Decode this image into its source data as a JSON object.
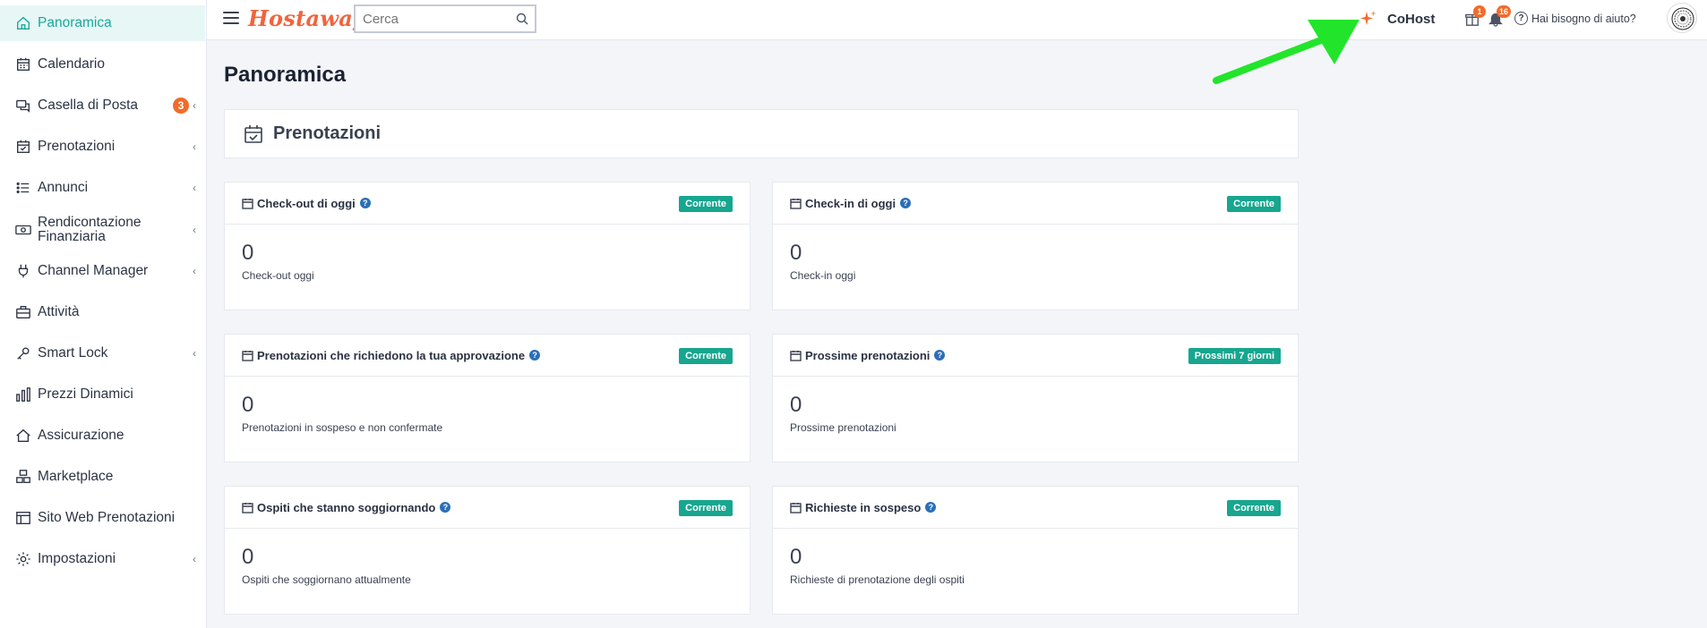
{
  "sidebar": {
    "items": [
      {
        "label": "Panoramica",
        "icon": "home-icon",
        "active": true
      },
      {
        "label": "Calendario",
        "icon": "calendar-icon"
      },
      {
        "label": "Casella di Posta",
        "icon": "chat-icon",
        "badge": "3",
        "chevron": "‹"
      },
      {
        "label": "Prenotazioni",
        "icon": "calendar-check-icon",
        "chevron": "‹"
      },
      {
        "label": "Annunci",
        "icon": "list-icon",
        "chevron": "‹"
      },
      {
        "label": "Rendicontazione Finanziaria",
        "icon": "money-icon",
        "chevron": "‹"
      },
      {
        "label": "Channel Manager",
        "icon": "plug-icon",
        "chevron": "‹"
      },
      {
        "label": "Attività",
        "icon": "briefcase-icon"
      },
      {
        "label": "Smart Lock",
        "icon": "key-icon",
        "chevron": "‹"
      },
      {
        "label": "Prezzi Dinamici",
        "icon": "bar-chart-icon"
      },
      {
        "label": "Assicurazione",
        "icon": "house-shield-icon"
      },
      {
        "label": "Marketplace",
        "icon": "boxes-icon"
      },
      {
        "label": "Sito Web Prenotazioni",
        "icon": "layout-icon"
      },
      {
        "label": "Impostazioni",
        "icon": "gear-icon",
        "chevron": "‹"
      }
    ]
  },
  "topbar": {
    "logo": "Hostaway",
    "search_placeholder": "Cerca",
    "cohost_label": "CoHost",
    "gift_badge": "1",
    "bell_badge": "16",
    "help_label": "Hai bisogno di aiuto?"
  },
  "main": {
    "page_title": "Panoramica",
    "section_title": "Prenotazioni",
    "cards": [
      {
        "title": "Check-out di oggi",
        "tag": "Corrente",
        "value": "0",
        "desc": "Check-out oggi"
      },
      {
        "title": "Check-in di oggi",
        "tag": "Corrente",
        "value": "0",
        "desc": "Check-in oggi"
      },
      {
        "title": "Prenotazioni che richiedono la tua approvazione",
        "tag": "Corrente",
        "value": "0",
        "desc": "Prenotazioni in sospeso e non confermate"
      },
      {
        "title": "Prossime prenotazioni",
        "tag": "Prossimi 7 giorni",
        "value": "0",
        "desc": "Prossime prenotazioni"
      },
      {
        "title": "Ospiti che stanno soggiornando",
        "tag": "Corrente",
        "value": "0",
        "desc": "Ospiti che soggiornano attualmente"
      },
      {
        "title": "Richieste in sospeso",
        "tag": "Corrente",
        "value": "0",
        "desc": "Richieste di prenotazione degli ospiti"
      }
    ]
  },
  "colors": {
    "accent": "#18a89b",
    "brand": "#f1643d",
    "tag": "#17a68f",
    "badge": "#f26b2a",
    "annotation_arrow": "#22e52b"
  }
}
